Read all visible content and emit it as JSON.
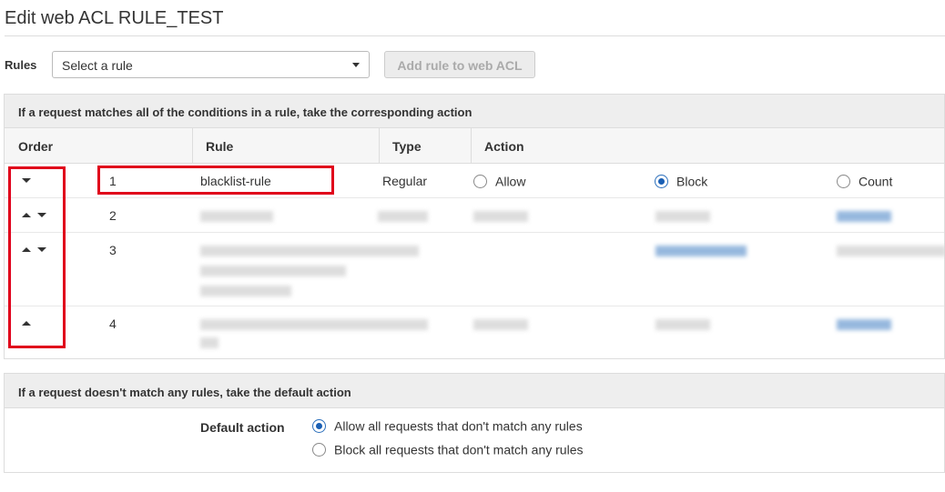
{
  "page": {
    "title": "Edit web ACL RULE_TEST"
  },
  "toolbar": {
    "rules_label": "Rules",
    "select_value": "Select a rule",
    "add_button": "Add rule to web ACL"
  },
  "rules_panel": {
    "header": "If a request matches all of the conditions in a rule, take the corresponding action",
    "columns": [
      "Order",
      "Rule",
      "Type",
      "Action"
    ],
    "rows": [
      {
        "order": "1",
        "rule": "blacklist-rule",
        "type": "Regular",
        "actions": [
          {
            "label": "Allow",
            "selected": false
          },
          {
            "label": "Block",
            "selected": true
          },
          {
            "label": "Count",
            "selected": false
          }
        ]
      },
      {
        "order": "2"
      },
      {
        "order": "3"
      },
      {
        "order": "4"
      }
    ]
  },
  "default_panel": {
    "header": "If a request doesn't match any rules, take the default action",
    "label": "Default action",
    "options": [
      {
        "label": "Allow all requests that don't match any rules",
        "selected": true
      },
      {
        "label": "Block all requests that don't match any rules",
        "selected": false
      }
    ]
  },
  "colors": {
    "highlight": "#e0001b",
    "radio_selected": "#1a5fb4",
    "header_bg": "#eeeeee"
  }
}
